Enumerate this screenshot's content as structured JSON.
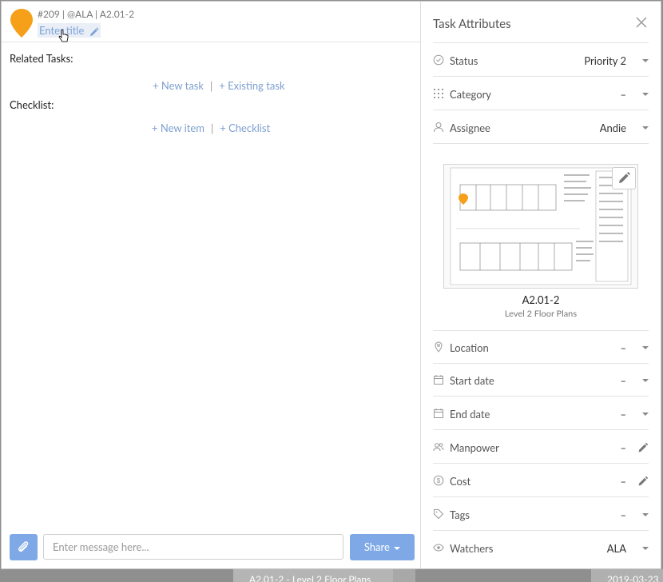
{
  "background": {
    "sheet_strip": "A2.01-2 - Level 2 Floor Plans",
    "date_strip": "2019-03-23"
  },
  "header": {
    "meta": "#209 | @ALA | A2.01-2",
    "title_placeholder": "Enter title"
  },
  "left": {
    "related_tasks_label": "Related Tasks:",
    "new_task": "+ New task",
    "existing_task": "+ Existing task",
    "checklist_label": "Checklist:",
    "new_item": "+ New item",
    "checklist_link": "+ Checklist",
    "separator": "|"
  },
  "composer": {
    "placeholder": "Enter message here...",
    "share_label": "Share"
  },
  "panel": {
    "title": "Task Attributes",
    "status": {
      "label": "Status",
      "value": "Priority 2"
    },
    "category": {
      "label": "Category",
      "value": "–"
    },
    "assignee": {
      "label": "Assignee",
      "value": "Andie"
    },
    "sheet": {
      "name": "A2.01-2",
      "description": "Level 2 Floor Plans"
    },
    "location": {
      "label": "Location",
      "value": "–"
    },
    "start_date": {
      "label": "Start date",
      "value": "–"
    },
    "end_date": {
      "label": "End date",
      "value": "–"
    },
    "manpower": {
      "label": "Manpower",
      "value": "–"
    },
    "cost": {
      "label": "Cost",
      "value": "–"
    },
    "tags": {
      "label": "Tags",
      "value": "–"
    },
    "watchers": {
      "label": "Watchers",
      "value": "ALA"
    }
  },
  "colors": {
    "accent": "#7ea8e6",
    "pin": "#f6a01a",
    "link": "#7ea0cf"
  }
}
